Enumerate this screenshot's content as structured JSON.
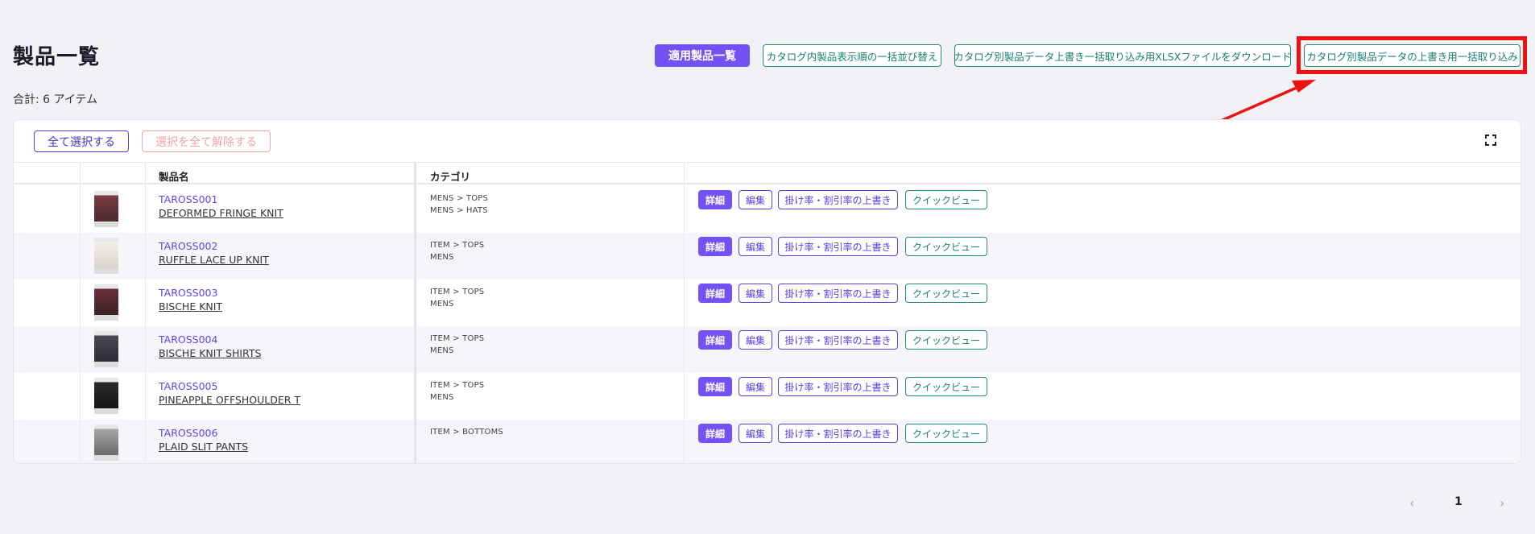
{
  "header": {
    "title": "製品一覧",
    "total": "合計: 6 アイテム",
    "buttons": {
      "applied_list": "適用製品一覧",
      "bulk_sort": "カタログ内製品表示順の一括並び替え",
      "download_xlsx": "カタログ別製品データ上書き一括取り込み用XLSXファイルをダウンロード",
      "bulk_import": "カタログ別製品データの上書き用一括取り込み"
    }
  },
  "selection": {
    "select_all": "全て選択する",
    "deselect_all": "選択を全て解除する"
  },
  "table": {
    "columns": {
      "name": "製品名",
      "category": "カテゴリ"
    },
    "actions": {
      "detail": "詳細",
      "edit": "編集",
      "rate": "掛け率・割引率の上書き",
      "quick": "クイックビュー"
    },
    "rows": [
      {
        "code": "TAROSS001",
        "name": "DEFORMED FRINGE KNIT",
        "cat1": "MENS > TOPS",
        "cat2": "MENS > HATS"
      },
      {
        "code": "TAROSS002",
        "name": "RUFFLE LACE UP KNIT",
        "cat1": "ITEM > TOPS",
        "cat2": "MENS"
      },
      {
        "code": "TAROSS003",
        "name": "BISCHE KNIT",
        "cat1": "ITEM > TOPS",
        "cat2": "MENS"
      },
      {
        "code": "TAROSS004",
        "name": "BISCHE KNIT SHIRTS",
        "cat1": "ITEM > TOPS",
        "cat2": "MENS"
      },
      {
        "code": "TAROSS005",
        "name": "PINEAPPLE OFFSHOULDER T",
        "cat1": "ITEM > TOPS",
        "cat2": "MENS"
      },
      {
        "code": "TAROSS006",
        "name": "PLAID SLIT PANTS",
        "cat1": "ITEM > BOTTOMS",
        "cat2": ""
      }
    ]
  },
  "pagination": {
    "prev": "‹",
    "current": "1",
    "next": "›"
  },
  "colors": {
    "accent": "#7352f5",
    "teal": "#1e8a7c",
    "highlight": "#ef1111"
  }
}
